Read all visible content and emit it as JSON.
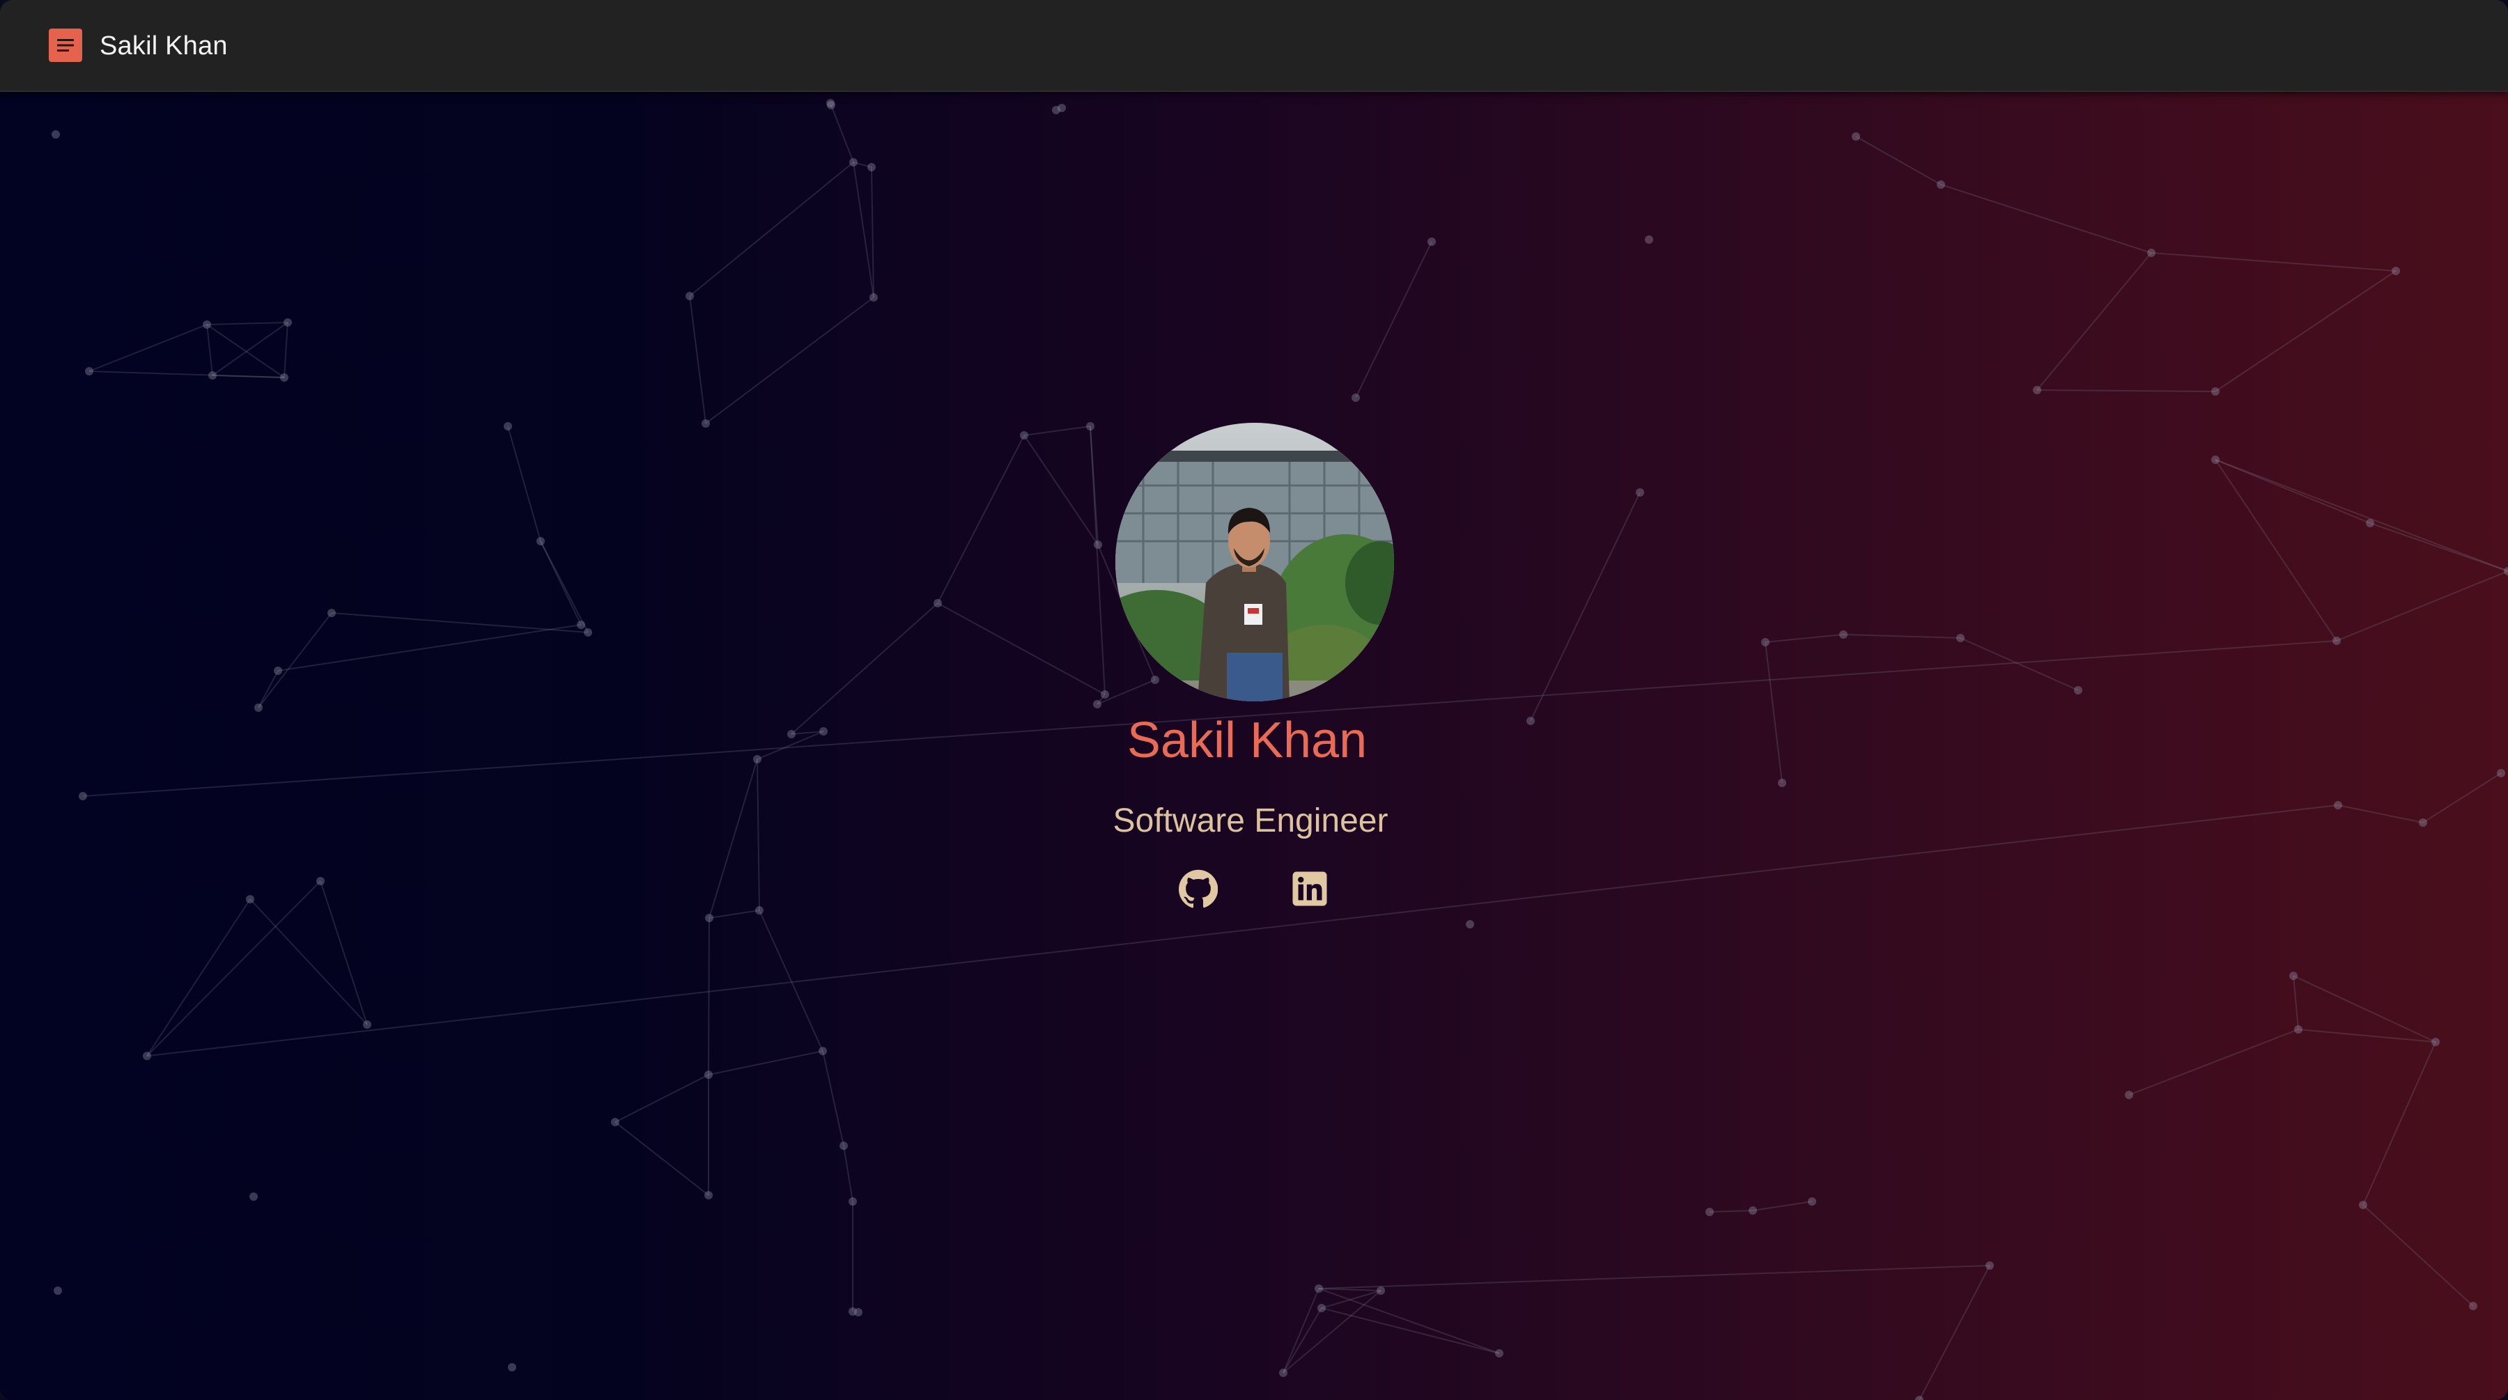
{
  "header": {
    "menu_icon": "menu-icon",
    "site_title": "Sakil Khan",
    "accent_color": "#e5634c"
  },
  "hero": {
    "name": "Sakil Khan",
    "title": "Software Engineer",
    "name_color": "#e96a55",
    "title_color": "#dcc39d",
    "avatar_alt": "Sakil Khan",
    "social": [
      {
        "icon": "github-icon",
        "label": "GitHub"
      },
      {
        "icon": "linkedin-icon",
        "label": "LinkedIn"
      }
    ]
  },
  "background": {
    "gradient_colors": [
      "#020222",
      "#1a0521",
      "#4a0e1c"
    ],
    "effect": "particle-network"
  }
}
